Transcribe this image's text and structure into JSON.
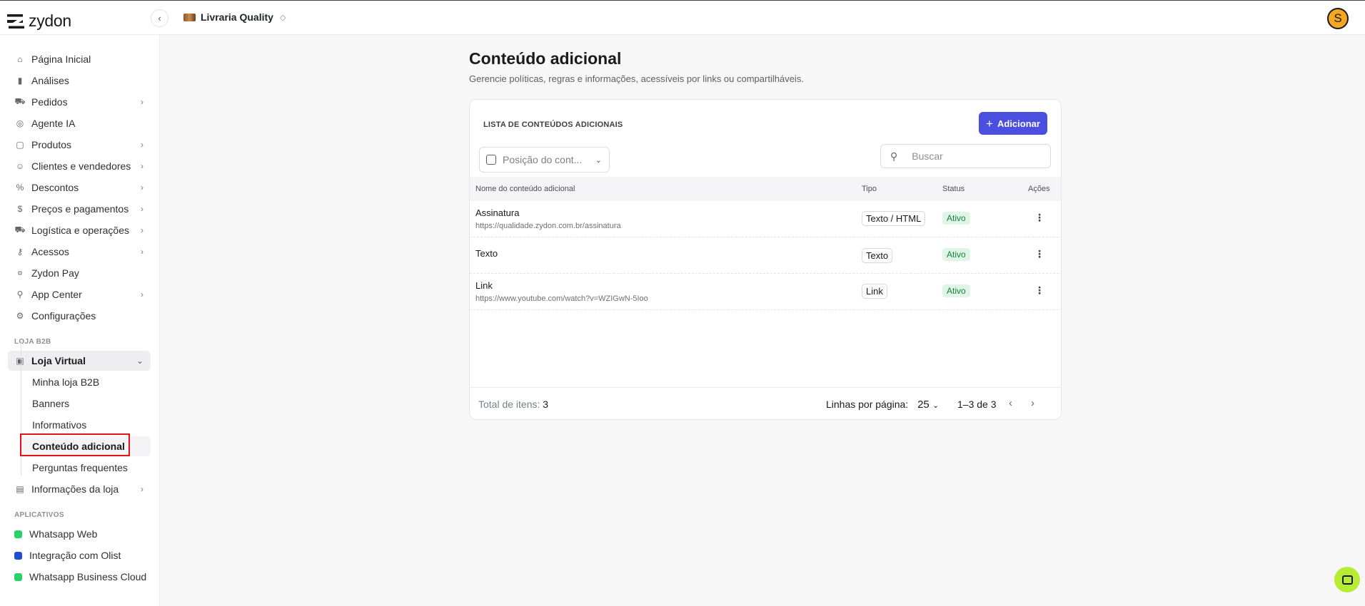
{
  "header": {
    "brand": "zydon",
    "store_name": "Livraria Quality",
    "avatar_initial": "S"
  },
  "sidebar": {
    "items": [
      {
        "label": "Página Inicial",
        "icon": "home-icon"
      },
      {
        "label": "Análises",
        "icon": "bar-chart-icon"
      },
      {
        "label": "Pedidos",
        "icon": "cart-icon",
        "expandable": true
      },
      {
        "label": "Agente IA",
        "icon": "ai-agent-icon"
      },
      {
        "label": "Produtos",
        "icon": "box-icon",
        "expandable": true
      },
      {
        "label": "Clientes e vendedores",
        "icon": "users-icon",
        "expandable": true
      },
      {
        "label": "Descontos",
        "icon": "discount-icon",
        "expandable": true
      },
      {
        "label": "Preços e pagamentos",
        "icon": "dollar-icon",
        "expandable": true
      },
      {
        "label": "Logística e operações",
        "icon": "truck-icon",
        "expandable": true
      },
      {
        "label": "Acessos",
        "icon": "key-users-icon",
        "expandable": true
      },
      {
        "label": "Zydon Pay",
        "icon": "pay-icon"
      },
      {
        "label": "App Center",
        "icon": "plug-icon",
        "expandable": true
      },
      {
        "label": "Configurações",
        "icon": "gear-icon"
      }
    ],
    "section_b2b": "LOJA B2B",
    "loja_virtual": {
      "label": "Loja Virtual",
      "icon": "storefront-icon"
    },
    "sub_items": [
      "Minha loja B2B",
      "Banners",
      "Informativos",
      "Conteúdo adicional",
      "Perguntas frequentes"
    ],
    "informacoes_loja": {
      "label": "Informações da loja",
      "icon": "id-card-icon"
    },
    "section_apps": "APLICATIVOS",
    "apps": [
      {
        "label": "Whatsapp Web",
        "color": "#25d366"
      },
      {
        "label": "Integração com Olist",
        "color": "#1f4fd1"
      },
      {
        "label": "Whatsapp Business Cloud",
        "color": "#25d366"
      }
    ]
  },
  "main": {
    "title": "Conteúdo adicional",
    "subtitle": "Gerencie políticas, regras e informações, acessíveis por links ou compartilháveis.",
    "card_title": "LISTA DE CONTEÚDOS ADICIONAIS",
    "add_button": "Adicionar",
    "position_select_value": "Posição do cont...",
    "search_placeholder": "Buscar",
    "columns": {
      "name": "Nome do conteúdo adicional",
      "type": "Tipo",
      "status": "Status",
      "actions": "Ações"
    },
    "rows": [
      {
        "name": "Assinatura",
        "url": "https://qualidade.zydon.com.br/assinatura",
        "type": "Texto / HTML",
        "status": "Ativo"
      },
      {
        "name": "Texto",
        "url": "",
        "type": "Texto",
        "status": "Ativo"
      },
      {
        "name": "Link",
        "url": "https://www.youtube.com/watch?v=WZIGwN-5Ioo",
        "type": "Link",
        "status": "Ativo"
      }
    ],
    "footer": {
      "total_label": "Total de itens:",
      "total_value": "3",
      "rows_per_page_label": "Linhas por página:",
      "rows_per_page_value": "25",
      "range": "1–3 de 3"
    }
  },
  "colors": {
    "accent": "#4a4fe0",
    "status_active_bg": "#dff5e5",
    "status_active_text": "#17803d",
    "highlight": "#e0131a",
    "chat_button": "#b7ec35"
  }
}
